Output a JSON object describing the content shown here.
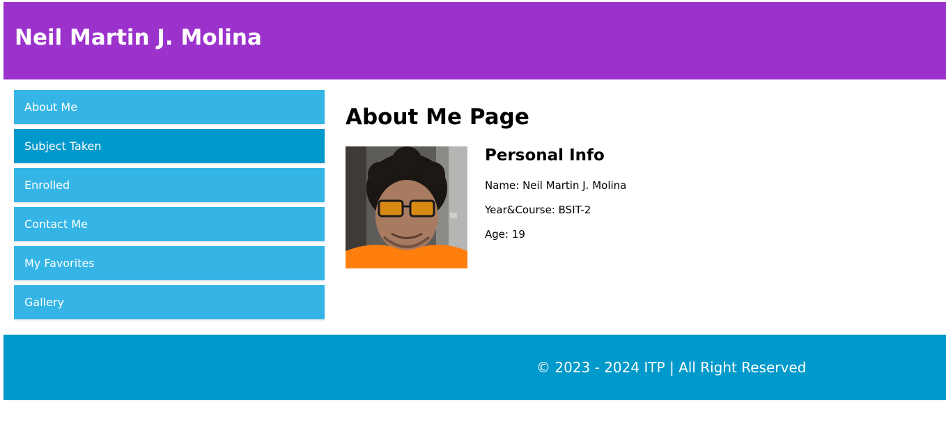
{
  "header": {
    "title": "Neil Martin J. Molina"
  },
  "sidebar": {
    "items": [
      {
        "label": "About Me"
      },
      {
        "label": "Subject Taken"
      },
      {
        "label": "Enrolled"
      },
      {
        "label": "Contact Me"
      },
      {
        "label": "My Favorites"
      },
      {
        "label": "Gallery"
      }
    ],
    "active_item": "Subject Taken"
  },
  "main": {
    "page_title": "About Me Page",
    "profile_photo": "person-photo",
    "personal_info": {
      "heading": "Personal Info",
      "name": "Name: Neil Martin J. Molina",
      "year_course": "Year&Course: BSIT-2",
      "age": "Age: 19"
    }
  },
  "footer": {
    "text": "© 2023 - 2024 ITP | All Right Reserved"
  },
  "colors": {
    "header_bg": "#9b32cc",
    "nav_item_bg": "#35b5e6",
    "nav_item_active_bg": "#0099cb",
    "footer_bg": "#0099cb"
  }
}
